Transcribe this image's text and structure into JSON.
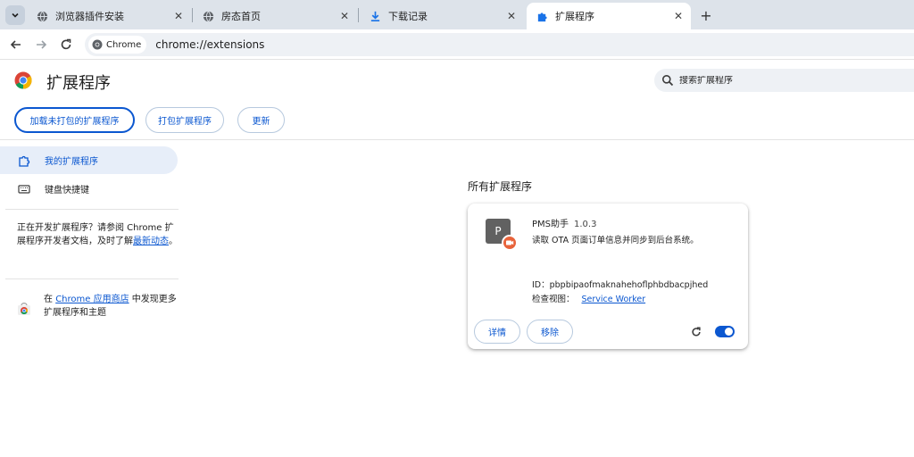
{
  "tabs": [
    {
      "label": "浏览器插件安装",
      "icon": "globe-icon"
    },
    {
      "label": "房态首页",
      "icon": "globe-icon"
    },
    {
      "label": "下载记录",
      "icon": "download-icon"
    },
    {
      "label": "扩展程序",
      "icon": "puzzle-icon",
      "active": true
    }
  ],
  "toolbar": {
    "chip_label": "Chrome",
    "url": "chrome://extensions"
  },
  "header": {
    "title": "扩展程序",
    "search_placeholder": "搜索扩展程序",
    "buttons": {
      "load_unpacked": "加载未打包的扩展程序",
      "pack": "打包扩展程序",
      "update": "更新"
    }
  },
  "sidebar": {
    "items": [
      {
        "label": "我的扩展程序",
        "icon": "extension-outline-icon"
      },
      {
        "label": "键盘快捷键",
        "icon": "keyboard-icon"
      }
    ],
    "dev_text_prefix": "正在开发扩展程序？请参阅 Chrome 扩展程序开发者文档，及时了解",
    "dev_link": "最新动态",
    "dev_text_suffix": "。",
    "store_prefix": "在 ",
    "store_link": "Chrome 应用商店",
    "store_suffix": " 中发现更多扩展程序和主题"
  },
  "main": {
    "section_title": "所有扩展程序",
    "extension": {
      "icon_letter": "P",
      "name": "PMS助手",
      "version": "1.0.3",
      "description": "读取 OTA 页面订单信息并同步到后台系统。",
      "id_label": "ID：",
      "id": "pbpbipaofmaknahehoflphbdbacpjhed",
      "inspect_label": "检查视图：",
      "inspect_link": "Service Worker",
      "details_label": "详情",
      "remove_label": "移除",
      "enabled": true
    }
  },
  "colors": {
    "accent": "#0b57d0",
    "tabstrip": "#dde3ea",
    "badge": "#e8633b",
    "selected_bg": "#e7eef9"
  }
}
